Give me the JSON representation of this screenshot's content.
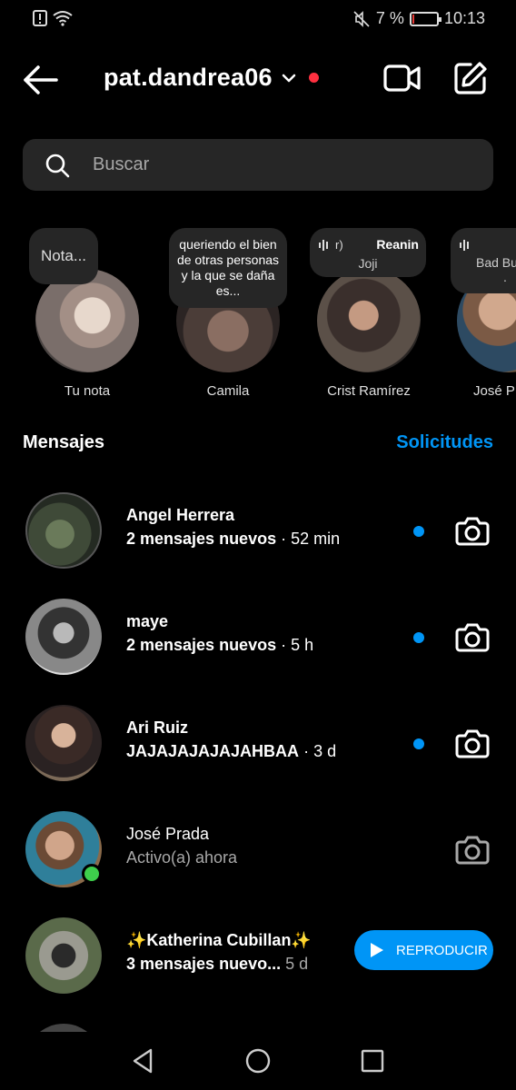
{
  "status_bar": {
    "battery": "7 %",
    "battery_level": 0.07,
    "time": "10:13"
  },
  "header": {
    "username": "pat.dandrea06"
  },
  "search": {
    "placeholder": "Buscar"
  },
  "notes": [
    {
      "label": "Tu nota",
      "bubble": "Nota..."
    },
    {
      "label": "Camila",
      "bubble": "queriendo el bien de otras personas y la que se daña es..."
    },
    {
      "label": "Crist Ramírez",
      "bubble_song": "Reanin",
      "bubble_song_prefix": "r)",
      "bubble_artist": "Joji"
    },
    {
      "label": "José P",
      "bubble_artist": "Bad Bu",
      "bubble_extra": "."
    }
  ],
  "section": {
    "title": "Mensajes",
    "requests": "Solicitudes"
  },
  "messages": [
    {
      "name": "Angel Herrera",
      "preview": "2 mensajes nuevos",
      "time": "52 min",
      "unread": true
    },
    {
      "name": "maye",
      "preview": "2 mensajes nuevos",
      "time": "5 h",
      "unread": true
    },
    {
      "name": "Ari Ruiz",
      "preview": "JAJAJAJAJAJAHBAA",
      "time": "3 d",
      "unread": true
    },
    {
      "name": "José Prada",
      "preview": "Activo(a) ahora",
      "time": "",
      "unread": false,
      "online": true
    },
    {
      "name": "✨Katherina Cubillan✨",
      "preview": "3 mensajes nuevo...",
      "time": "5 d",
      "unread": false,
      "action": "REPRODUCIR"
    }
  ],
  "colors": {
    "accent": "#0095f6",
    "unread": "#0095f6",
    "online": "#3ecf4c",
    "alert": "#ff3040"
  },
  "icons": [
    "back-arrow-icon",
    "chevron-down-icon",
    "video-call-icon",
    "compose-icon",
    "search-icon",
    "camera-icon",
    "play-icon",
    "nav-back-icon",
    "nav-home-icon",
    "nav-recents-icon"
  ]
}
